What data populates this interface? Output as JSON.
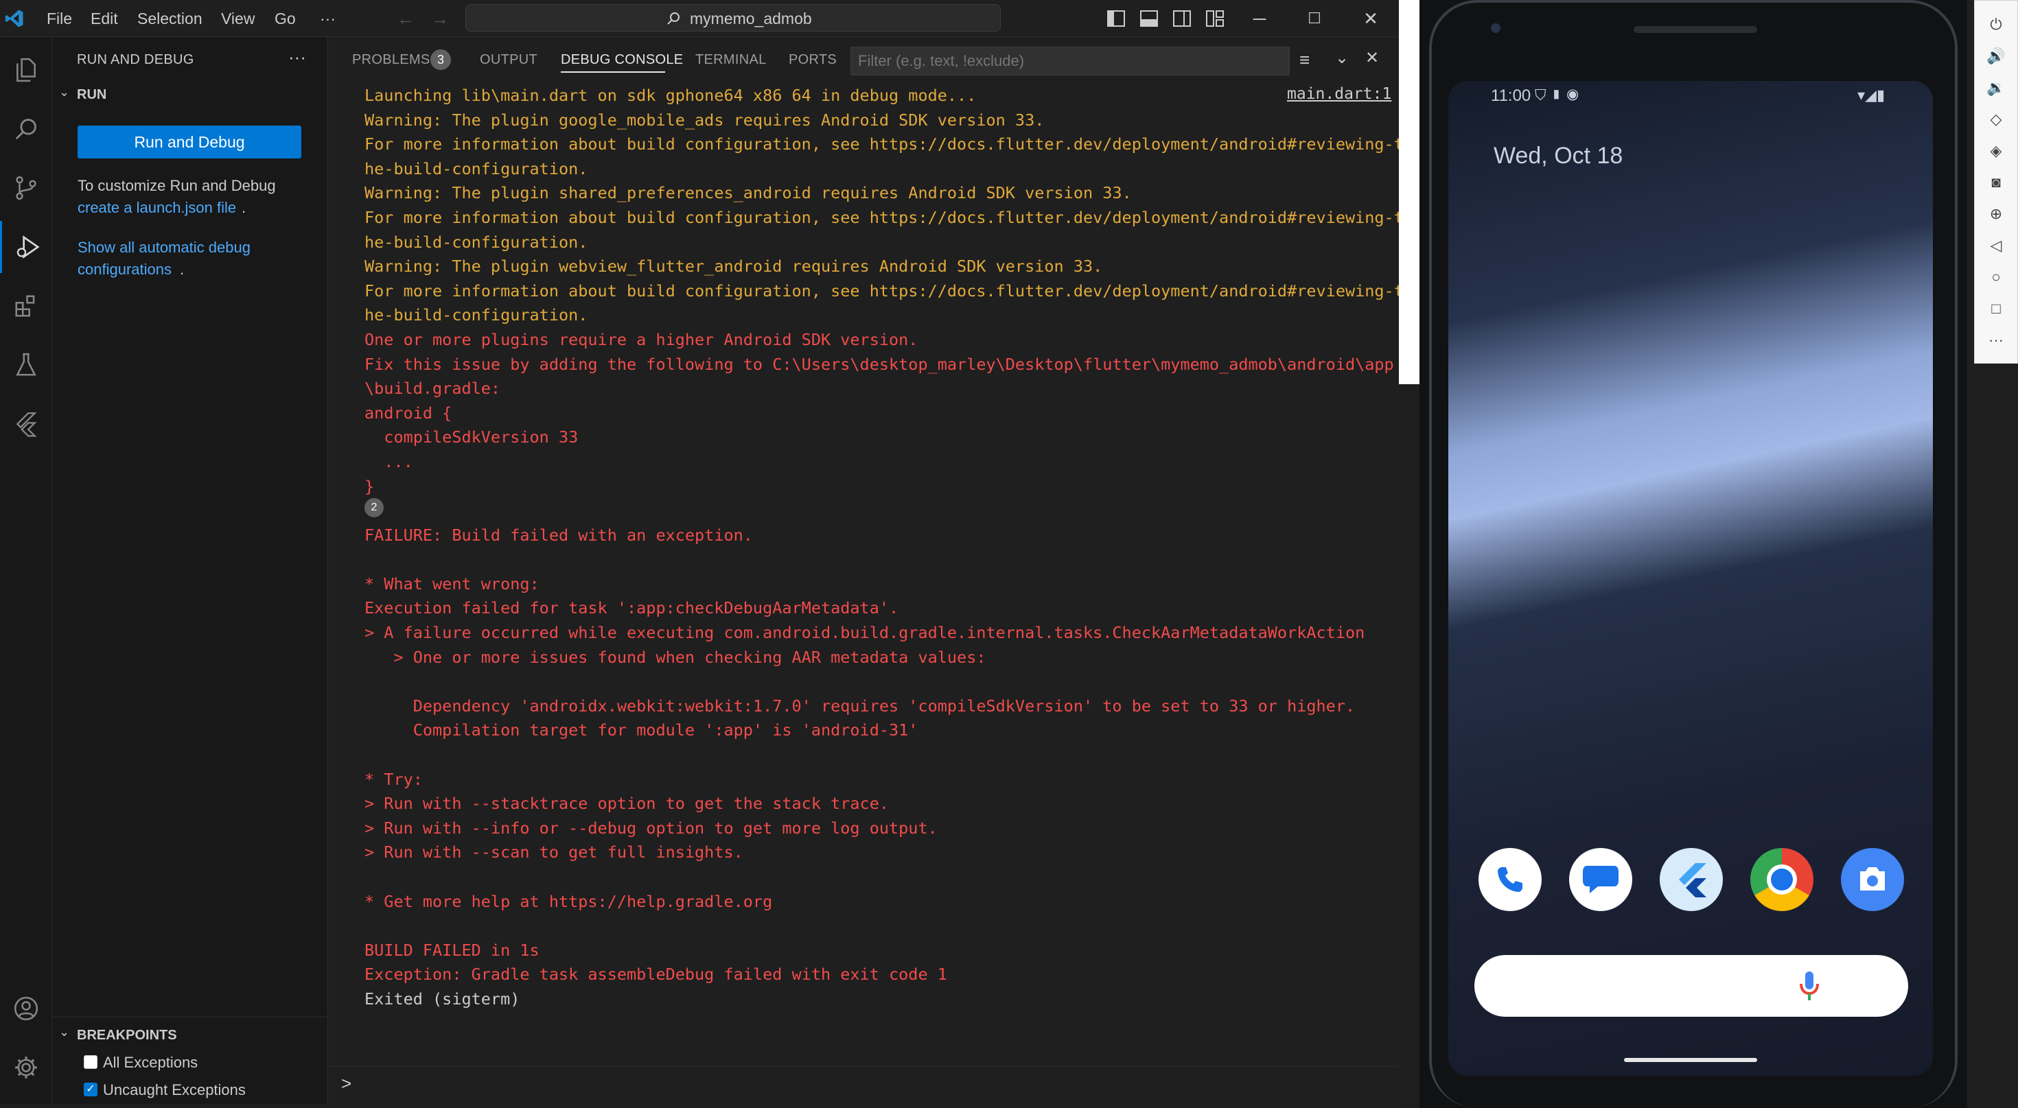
{
  "titlebar": {
    "menus": [
      "File",
      "Edit",
      "Selection",
      "View",
      "Go",
      "···"
    ],
    "search_text": "mymemo_admob"
  },
  "sidebar": {
    "title": "RUN AND DEBUG",
    "section": "RUN",
    "run_button": "Run and Debug",
    "customize_text": "To customize Run and Debug",
    "launch_link": "create a launch.json file",
    "show_link_1": "Show all automatic debug",
    "show_link_2": "configurations",
    "breakpoints_title": "BREAKPOINTS",
    "breakpoints": [
      {
        "label": "All Exceptions",
        "checked": false
      },
      {
        "label": "Uncaught Exceptions",
        "checked": true
      }
    ]
  },
  "panel": {
    "tabs": [
      "PROBLEMS",
      "OUTPUT",
      "DEBUG CONSOLE",
      "TERMINAL",
      "PORTS"
    ],
    "problems_count": "3",
    "filter_placeholder": "Filter (e.g. text, !exclude)",
    "source_link": "main.dart:1",
    "repeat_badge": "2",
    "lines": [
      {
        "t": "Launching lib\\main.dart on sdk gphone64 x86 64 in debug mode...",
        "c": "w"
      },
      {
        "t": "Warning: The plugin google_mobile_ads requires Android SDK version 33.",
        "c": "w"
      },
      {
        "t": "For more information about build configuration, see https://docs.flutter.dev/deployment/android#reviewing-t",
        "c": "w"
      },
      {
        "t": "he-build-configuration.",
        "c": "w"
      },
      {
        "t": "Warning: The plugin shared_preferences_android requires Android SDK version 33.",
        "c": "w"
      },
      {
        "t": "For more information about build configuration, see https://docs.flutter.dev/deployment/android#reviewing-t",
        "c": "w"
      },
      {
        "t": "he-build-configuration.",
        "c": "w"
      },
      {
        "t": "Warning: The plugin webview_flutter_android requires Android SDK version 33.",
        "c": "w"
      },
      {
        "t": "For more information about build configuration, see https://docs.flutter.dev/deployment/android#reviewing-t",
        "c": "w"
      },
      {
        "t": "he-build-configuration.",
        "c": "w"
      },
      {
        "t": "One or more plugins require a higher Android SDK version.",
        "c": "e"
      },
      {
        "t": "Fix this issue by adding the following to C:\\Users\\desktop_marley\\Desktop\\flutter\\mymemo_admob\\android\\app",
        "c": "e"
      },
      {
        "t": "\\build.gradle:",
        "c": "e"
      },
      {
        "t": "android {",
        "c": "e"
      },
      {
        "t": "  compileSdkVersion 33",
        "c": "e"
      },
      {
        "t": "  ...",
        "c": "e"
      },
      {
        "t": "}",
        "c": "e"
      },
      {
        "t": "",
        "c": "e"
      },
      {
        "t": "FAILURE: Build failed with an exception.",
        "c": "e"
      },
      {
        "t": "",
        "c": "e"
      },
      {
        "t": "* What went wrong:",
        "c": "e"
      },
      {
        "t": "Execution failed for task ':app:checkDebugAarMetadata'.",
        "c": "e"
      },
      {
        "t": "> A failure occurred while executing com.android.build.gradle.internal.tasks.CheckAarMetadataWorkAction",
        "c": "e"
      },
      {
        "t": "   > One or more issues found when checking AAR metadata values:",
        "c": "e"
      },
      {
        "t": "",
        "c": "e"
      },
      {
        "t": "     Dependency 'androidx.webkit:webkit:1.7.0' requires 'compileSdkVersion' to be set to 33 or higher.",
        "c": "e"
      },
      {
        "t": "     Compilation target for module ':app' is 'android-31'",
        "c": "e"
      },
      {
        "t": "",
        "c": "e"
      },
      {
        "t": "* Try:",
        "c": "e"
      },
      {
        "t": "> Run with --stacktrace option to get the stack trace.",
        "c": "e"
      },
      {
        "t": "> Run with --info or --debug option to get more log output.",
        "c": "e"
      },
      {
        "t": "> Run with --scan to get full insights.",
        "c": "e"
      },
      {
        "t": "",
        "c": "e"
      },
      {
        "t": "* Get more help at https://help.gradle.org",
        "c": "e"
      },
      {
        "t": "",
        "c": "e"
      },
      {
        "t": "BUILD FAILED in 1s",
        "c": "e"
      },
      {
        "t": "Exception: Gradle task assembleDebug failed with exit code 1",
        "c": "e"
      },
      {
        "t": "Exited (sigterm)",
        "c": "n"
      }
    ],
    "prompt": ">"
  },
  "emulator": {
    "time": "11:00",
    "date": "Wed, Oct 18",
    "dock_apps": [
      "phone",
      "messages",
      "flutter",
      "chrome",
      "camera"
    ]
  },
  "colors": {
    "accent": "#0078d4",
    "warning": "#e0a93b",
    "error": "#f14c4c",
    "link": "#4daafc"
  }
}
